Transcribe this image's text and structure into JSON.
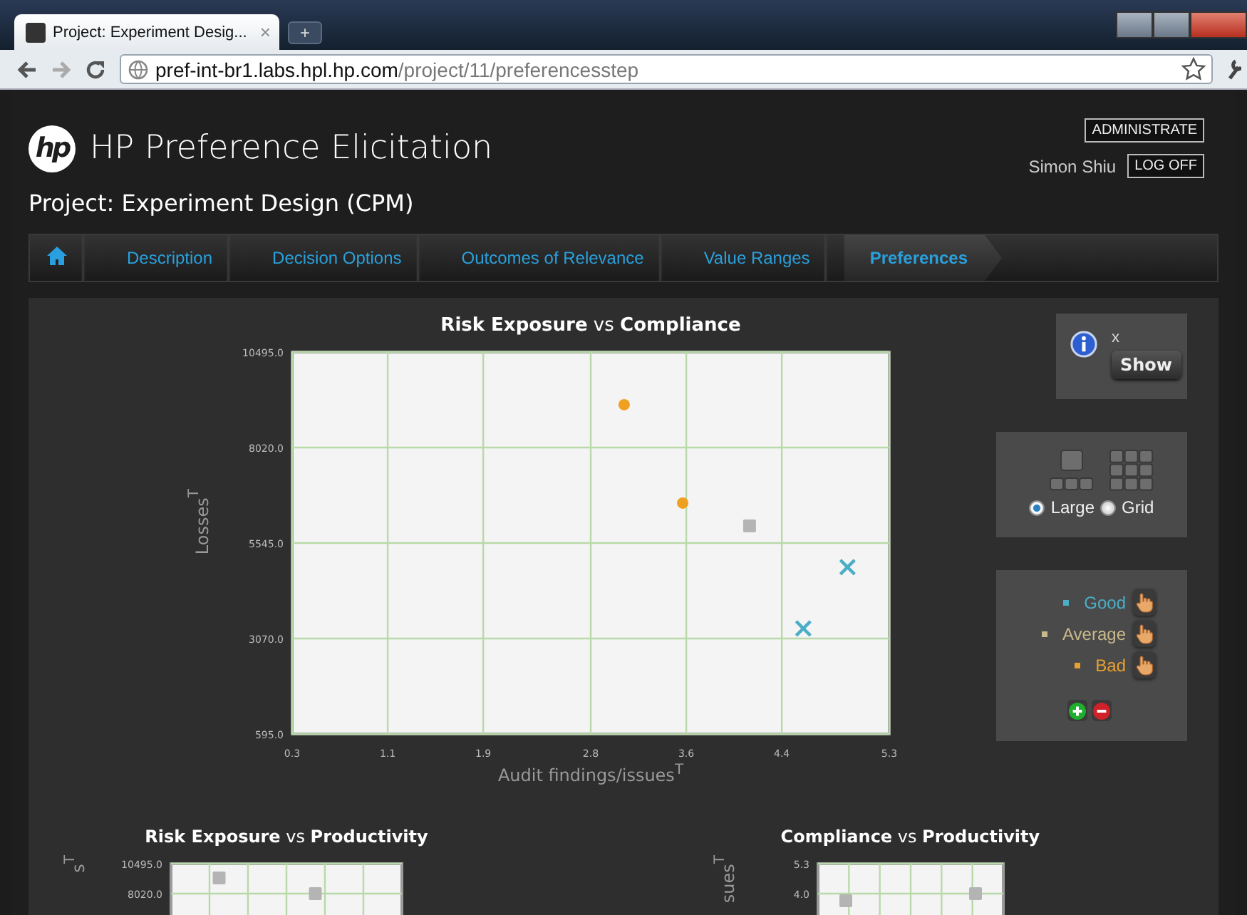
{
  "browser": {
    "tab_title": "Project: Experiment Desig...",
    "tab_close": "×",
    "new_tab": "+",
    "url_host": "pref-int-br1.labs.hpl.hp.com",
    "url_path": "/project/11/preferencesstep"
  },
  "header": {
    "logo": "hp",
    "title": "HP Preference Elicitation",
    "project": "Project: Experiment Design (CPM)",
    "admin_button": "ADMINISTRATE",
    "user": "Simon Shiu",
    "logoff_button": "LOG OFF"
  },
  "nav": [
    {
      "kind": "home",
      "selected": false
    },
    {
      "label": "Description",
      "selected": false
    },
    {
      "label": "Decision Options",
      "selected": false
    },
    {
      "label": "Outcomes of Relevance",
      "selected": false
    },
    {
      "label": "Value Ranges",
      "selected": false
    },
    {
      "label": "Preferences",
      "selected": true
    }
  ],
  "charts": [
    {
      "chart_data": {
        "type": "scatter",
        "title": "**Risk Exposure** vs **Compliance**",
        "xlabel": "Audit findings/issues$^{T}$",
        "ylabel": "Losses$^{T}$",
        "xlim": [
          0.3,
          5.3
        ],
        "ylim": [
          595,
          10495
        ],
        "grid": true,
        "xticks": [
          {
            "value": 0.3,
            "label": "0.3"
          },
          {
            "value": 1.1,
            "label": "1.1"
          },
          {
            "value": 1.9,
            "label": "1.9"
          },
          {
            "value": 2.8,
            "label": "2.8"
          },
          {
            "value": 3.6,
            "label": "3.6"
          },
          {
            "value": 4.4,
            "label": "4.4"
          },
          {
            "value": 5.3,
            "label": "5.3"
          }
        ],
        "yticks": [
          {
            "value": 595,
            "label": "595.0"
          },
          {
            "value": 3070,
            "label": "3070.0"
          },
          {
            "value": 5545,
            "label": "5545.0"
          },
          {
            "value": 8020,
            "label": "8020.0"
          },
          {
            "value": 10495,
            "label": "10495.0"
          }
        ],
        "series": [
          {
            "color": "#4aaec6",
            "marker": "cross",
            "x": [
              4.95,
              4.58
            ],
            "values": [
              4920,
              3330
            ]
          },
          {
            "color": "#b4b4b4",
            "marker": "square",
            "x": [
              4.13
            ],
            "values": [
              5990
            ]
          },
          {
            "color": "#f0a020",
            "marker": "circle",
            "x": [
              3.08,
              3.57
            ],
            "values": [
              9130,
              6580
            ]
          }
        ]
      }
    },
    {
      "chart_data": {
        "type": "scatter",
        "title": "**Risk Exposure** vs **Productivity**",
        "ylabel": "s$^{T}$",
        "grid": true,
        "ylim": [
          595,
          10495
        ],
        "categories": [
          null,
          null,
          null,
          null,
          null,
          null,
          null,
          null,
          null,
          null,
          null,
          null
        ],
        "yticks": [
          {
            "value": 8020,
            "label": "8020.0"
          },
          {
            "value": 10495,
            "label": "10495.0"
          }
        ],
        "series": [
          {
            "color": "#b4b4b4",
            "marker": "square",
            "values": [
              null,
              null,
              9320,
              null,
              null,
              null,
              null,
              8020,
              null,
              null,
              null,
              null
            ]
          }
        ]
      }
    },
    {
      "chart_data": {
        "type": "scatter",
        "title": "**Compliance** vs **Productivity**",
        "ylabel": "sues$^{T}$",
        "grid": true,
        "ylim": [
          0.1,
          5.3
        ],
        "categories": [
          null,
          null,
          null,
          null,
          null,
          null,
          null,
          null,
          null,
          null
        ],
        "yticks": [
          {
            "value": 4.0,
            "label": "4.0"
          },
          {
            "value": 5.3,
            "label": "5.3"
          }
        ],
        "series": [
          {
            "color": "#b4b4b4",
            "marker": "square",
            "values": [
              null,
              3.69,
              null,
              null,
              null,
              null,
              null,
              null,
              4.0,
              null
            ]
          }
        ]
      }
    }
  ],
  "info": {
    "close": "x",
    "button": "Show"
  },
  "layout_options": [
    {
      "label": "Large",
      "kind": "large",
      "selected": true
    },
    {
      "label": "Grid",
      "kind": "grid",
      "selected": false
    }
  ],
  "legend": [
    {
      "label": "Good",
      "color": "#4aaec6"
    },
    {
      "label": "Average",
      "color": "#c8b98c"
    },
    {
      "label": "Bad",
      "color": "#e8a030"
    }
  ]
}
